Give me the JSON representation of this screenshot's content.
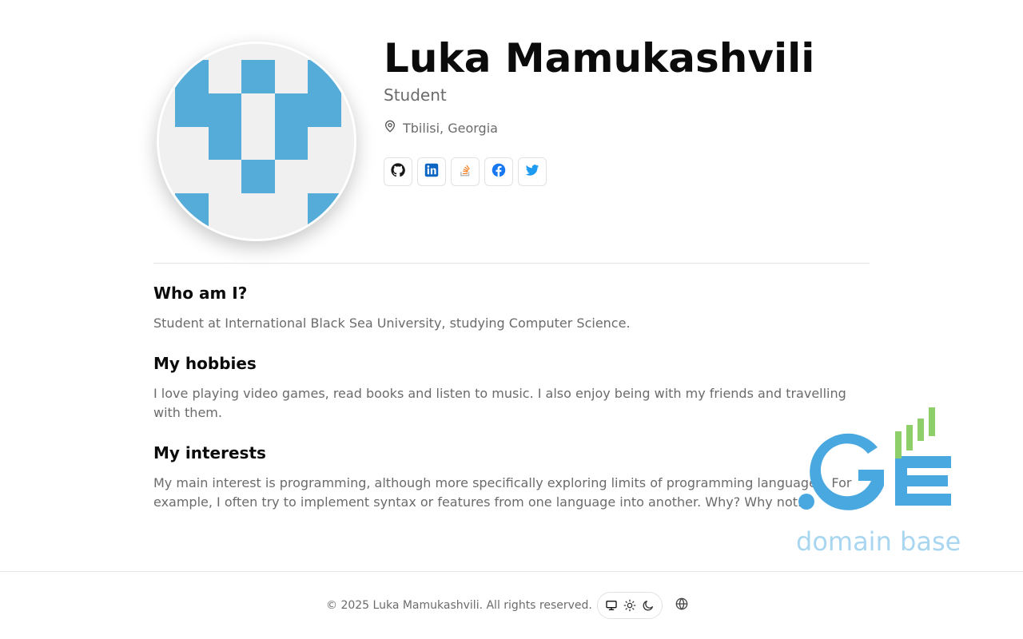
{
  "profile": {
    "name": "Luka Mamukashvili",
    "role": "Student",
    "location": "Tbilisi, Georgia",
    "socials": [
      {
        "name": "github-icon",
        "color": "#181717"
      },
      {
        "name": "linkedin-icon",
        "color": "#0a66c2"
      },
      {
        "name": "stackoverflow-icon",
        "color": "#f48024"
      },
      {
        "name": "facebook-icon",
        "color": "#1877f2"
      },
      {
        "name": "twitter-icon",
        "color": "#1d9bf0"
      }
    ],
    "avatar_colors": {
      "primary": "#55acd9",
      "background": "#f0f0f0"
    }
  },
  "sections": [
    {
      "title": "Who am I?",
      "body": "Student at International Black Sea University, studying Computer Science."
    },
    {
      "title": "My hobbies",
      "body": "I love playing video games, read books and listen to music. I also enjoy being with my friends and travelling with them."
    },
    {
      "title": "My interests",
      "body": "My main interest is programming, although more specifically exploring limits of programming languages. For example, I often try to implement syntax or features from one language into another. Why? Why not."
    }
  ],
  "watermark": {
    "logo_text": ".GE",
    "caption": "domain base",
    "colors": {
      "blue": "#4aa8e0",
      "green": "#8fcf6a"
    }
  },
  "footer": {
    "copyright": "© 2025 Luka Mamukashvili. All rights reserved.",
    "theme_options": [
      "monitor-icon",
      "sun-icon",
      "moon-icon"
    ],
    "language_icon": "globe-icon"
  }
}
